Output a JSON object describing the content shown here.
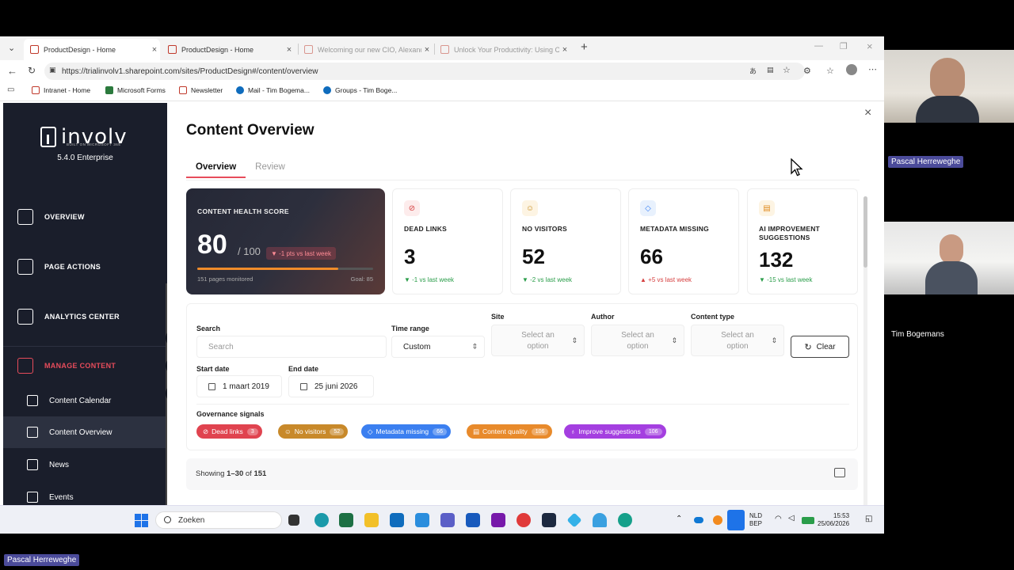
{
  "browser": {
    "tabs": [
      {
        "title": "ProductDesign - Home",
        "active": true
      },
      {
        "title": "ProductDesign - Home",
        "active": false
      },
      {
        "title": "Welcoming our new CIO, Alexandr",
        "active": false
      },
      {
        "title": "Unlock Your Productivity: Using C",
        "active": false
      }
    ],
    "new_tab": "+",
    "url": "https://trialinvolv1.sharepoint.com/sites/ProductDesign#/content/overview",
    "bookmarks": [
      "Intranet - Home",
      "Microsoft Forms",
      "Newsletter",
      "Mail - Tim Bogema...",
      "Groups - Tim Boge..."
    ]
  },
  "sidebar": {
    "brand": "involv",
    "brand_sub": "BUILT ON MICROSOFT 365",
    "version": "5.4.0  Enterprise",
    "nav": [
      {
        "label": "OVERVIEW",
        "icon": "grid-icon"
      },
      {
        "label": "PAGE ACTIONS",
        "icon": "page-edit-icon"
      },
      {
        "label": "ANALYTICS CENTER",
        "icon": "chart-icon"
      },
      {
        "label": "MANAGE CONTENT",
        "icon": "manage-content-icon"
      }
    ],
    "subnav": [
      {
        "label": "Content Calendar",
        "icon": "calendar-icon"
      },
      {
        "label": "Content Overview",
        "icon": "overview-icon"
      },
      {
        "label": "News",
        "icon": "news-icon"
      },
      {
        "label": "Events",
        "icon": "events-icon"
      }
    ]
  },
  "main": {
    "title": "Content Overview",
    "tabs": [
      "Overview",
      "Review"
    ],
    "health": {
      "label": "CONTENT HEALTH SCORE",
      "score": "80",
      "max": "/ 100",
      "badge": "▼ -1 pts vs last week",
      "progress": 0.8,
      "pages": "151 pages monitored",
      "goal": "Goal: 85"
    },
    "stats": [
      {
        "label": "DEAD LINKS",
        "value": "3",
        "trend": "▼ -1 vs last week",
        "dir": "down",
        "icon": "link-icon",
        "icon_bg": "#fdecec",
        "icon_color": "#d64040"
      },
      {
        "label": "NO VISITORS",
        "value": "52",
        "trend": "▼ -2 vs last week",
        "dir": "down",
        "icon": "users-icon",
        "icon_bg": "#fdf4e3",
        "icon_color": "#c58a1a"
      },
      {
        "label": "METADATA MISSING",
        "value": "66",
        "trend": "▲ +5 vs last week",
        "dir": "up",
        "icon": "tag-icon",
        "icon_bg": "#e8f1fd",
        "icon_color": "#3b82f6"
      },
      {
        "label": "AI IMPROVEMENT SUGGESTIONS",
        "value": "132",
        "trend": "▼ -15 vs last week",
        "dir": "down",
        "icon": "document-icon",
        "icon_bg": "#fdf4e3",
        "icon_color": "#e08a1e"
      }
    ],
    "filters": {
      "search_label": "Search",
      "search_placeholder": "Search",
      "time_label": "Time range",
      "time_value": "Custom",
      "site_label": "Site",
      "author_label": "Author",
      "ctype_label": "Content type",
      "select_placeholder_1": "Select an",
      "select_placeholder_2": "option",
      "clear_label": "Clear",
      "start_label": "Start date",
      "start_value": "1 maart 2019",
      "end_label": "End date",
      "end_value": "25 juni 2026",
      "signals_label": "Governance signals",
      "chips": [
        {
          "label": "Dead links",
          "count": "3",
          "color": "#e0434f"
        },
        {
          "label": "No visitors",
          "count": "52",
          "color": "#c8892a"
        },
        {
          "label": "Metadata missing",
          "count": "66",
          "color": "#3b7ff0"
        },
        {
          "label": "Content quality",
          "count": "106",
          "color": "#e88a2b"
        },
        {
          "label": "Improve suggestions",
          "count": "106",
          "color": "#a43fe0"
        }
      ]
    },
    "showing_prefix": "Showing ",
    "showing_range": "1–30",
    "showing_of": " of ",
    "showing_total": "151"
  },
  "taskbar": {
    "search": "Zoeken",
    "lang1": "NLD",
    "lang2": "BEP",
    "time": "15:53",
    "date": "25/06/2026"
  },
  "meeting": {
    "participants": [
      "Pascal Herreweghe",
      "Tim Bogemans"
    ],
    "self_label": "Pascal Herreweghe"
  }
}
